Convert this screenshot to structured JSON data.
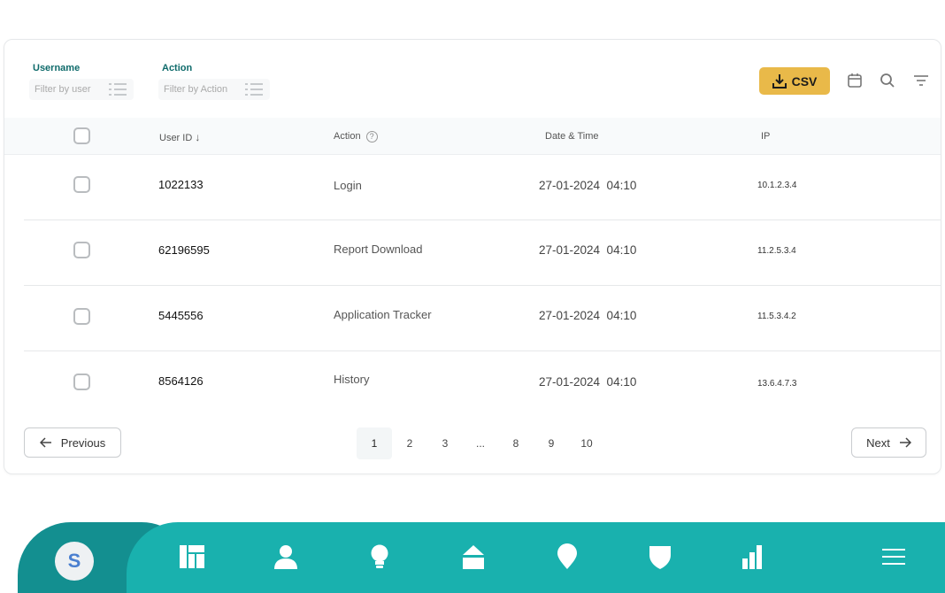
{
  "filters": {
    "username": {
      "label": "Username",
      "placeholder": "Filter by user"
    },
    "action": {
      "label": "Action",
      "placeholder": "Filter by Action"
    }
  },
  "toolbar": {
    "csv_label": "CSV",
    "icons": [
      "calendar-icon",
      "search-icon",
      "filter-icon"
    ]
  },
  "table": {
    "columns": [
      "User ID",
      "Action",
      "Date & Time",
      "IP"
    ],
    "rows": [
      {
        "user_id": "1022133",
        "action": "Login",
        "datetime": "27-01-2024  04:10",
        "ip": "10.1.2.3.4"
      },
      {
        "user_id": "62196595",
        "action": "Report Download",
        "datetime": "27-01-2024  04:10",
        "ip": "11.2.5.3.4"
      },
      {
        "user_id": "5445556",
        "action": "Application Tracker",
        "datetime": "27-01-2024  04:10",
        "ip": "11.5.3.4.2"
      },
      {
        "user_id": "8564126",
        "action": "History",
        "datetime": "27-01-2024  04:10",
        "ip": "13.6.4.7.3"
      }
    ]
  },
  "pagination": {
    "previous_label": "Previous",
    "next_label": "Next",
    "pages": [
      "1",
      "2",
      "3",
      "...",
      "8",
      "9",
      "10"
    ],
    "current": "1"
  },
  "bottom_nav": {
    "avatar_letter": "S",
    "items": [
      "dashboard-icon",
      "user-icon",
      "bulb-icon",
      "home-icon",
      "location-icon",
      "shield-icon",
      "bar-chart-icon",
      "menu-icon"
    ],
    "colors": {
      "bar": "#19b1ae",
      "active": "#138f90"
    }
  },
  "colors": {
    "accent": "#e9b949",
    "label": "#0f6b6b"
  }
}
